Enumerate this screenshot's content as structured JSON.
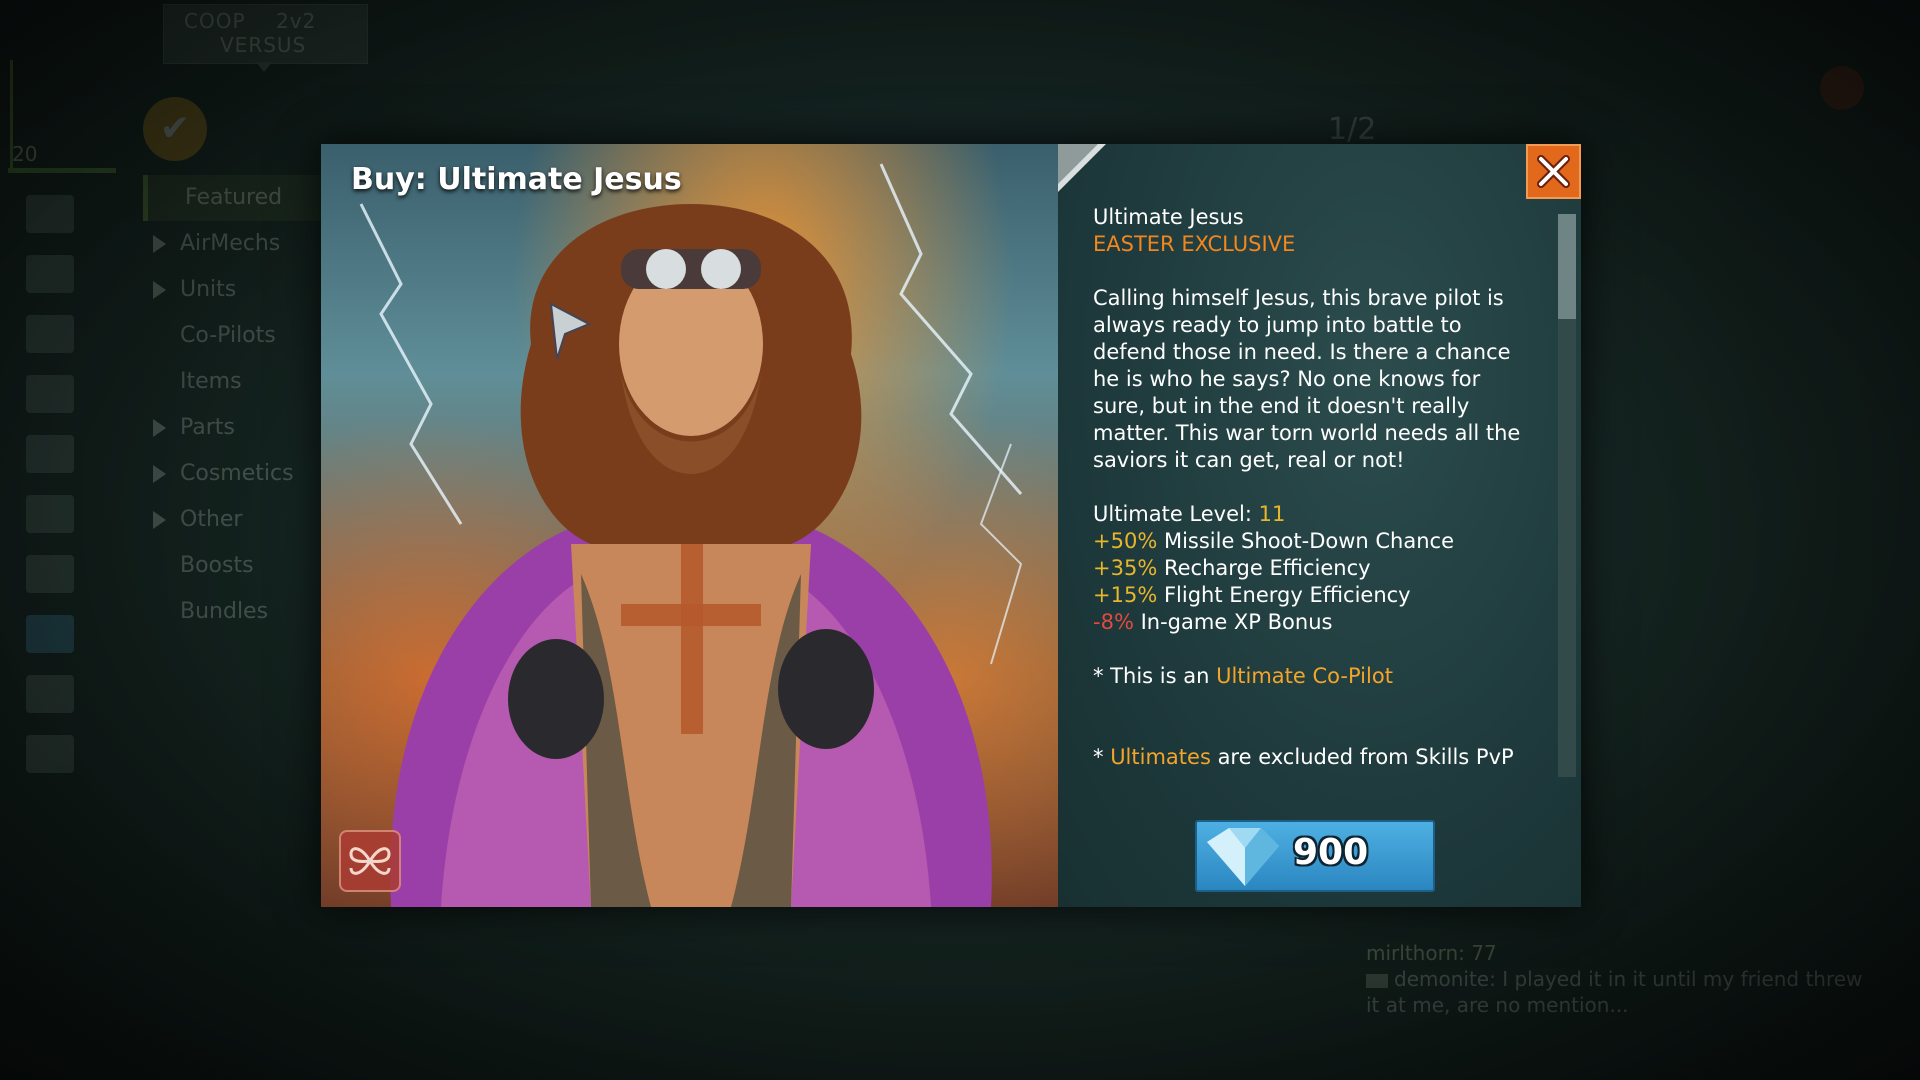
{
  "background": {
    "mode_tabs": {
      "coop": "COOP",
      "v2v": "2v2",
      "versus": "VERSUS"
    },
    "player_level": "20",
    "page_counter": "1/2",
    "nav_items": [
      {
        "label": "Featured",
        "arrow": false,
        "selected": true
      },
      {
        "label": "AirMechs",
        "arrow": true,
        "selected": false
      },
      {
        "label": "Units",
        "arrow": true,
        "selected": false
      },
      {
        "label": "Co-Pilots",
        "arrow": false,
        "selected": false
      },
      {
        "label": "Items",
        "arrow": false,
        "selected": false
      },
      {
        "label": "Parts",
        "arrow": true,
        "selected": false
      },
      {
        "label": "Cosmetics",
        "arrow": true,
        "selected": false
      },
      {
        "label": "Other",
        "arrow": true,
        "selected": false
      },
      {
        "label": "Boosts",
        "arrow": false,
        "selected": false
      },
      {
        "label": "Bundles",
        "arrow": false,
        "selected": false
      }
    ],
    "side_icons": [
      "pilots-icon",
      "cards-icon",
      "airmech-icon",
      "book-icon",
      "screen-icon",
      "crate-icon",
      "tower-icon",
      "shop-cart-icon",
      "social-icon",
      "arrows-icon",
      "stats-icon"
    ],
    "chat": {
      "line1_name": "mirlthorn: 77",
      "line2": "demonite: I played it in it until my friend threw",
      "line3": "it at me, are no mention..."
    }
  },
  "modal": {
    "title": "Buy: Ultimate Jesus",
    "item_name": "Ultimate Jesus",
    "exclusive_label": "EASTER EXCLUSIVE",
    "description": "Calling himself Jesus, this brave pilot is always ready to jump into battle to defend those in need. Is there a chance he is who he says? No one knows for sure, but in the end it doesn't really matter. This war torn world needs all the saviors it can get, real or not!",
    "level_label": "Ultimate Level: ",
    "level_value": "11",
    "stats": [
      {
        "value": "+50%",
        "label": " Missile Shoot-Down Chance",
        "color": "#e8b62c"
      },
      {
        "value": "+35%",
        "label": " Recharge Efficiency",
        "color": "#e8b62c"
      },
      {
        "value": "+15%",
        "label": " Flight Energy Efficiency",
        "color": "#e8b62c"
      },
      {
        "value": "-8%",
        "label": " In-game XP Bonus",
        "color": "#e24a3e"
      }
    ],
    "note1_prefix": "* This is an ",
    "note1_link": "Ultimate Co-Pilot",
    "note2_prefix": "* ",
    "note2_link": "Ultimates",
    "note2_suffix": " are excluded from Skills PvP",
    "price": "900",
    "currency_icon": "diamond-icon",
    "close_icon": "close-icon",
    "emblem_icon": "ultimate-emblem-icon",
    "colors": {
      "accent_orange": "#f3861d",
      "positive": "#e8b62c",
      "negative": "#e24a3e",
      "button_blue": "#3b9bd3",
      "close_orange": "#e2691c"
    }
  }
}
